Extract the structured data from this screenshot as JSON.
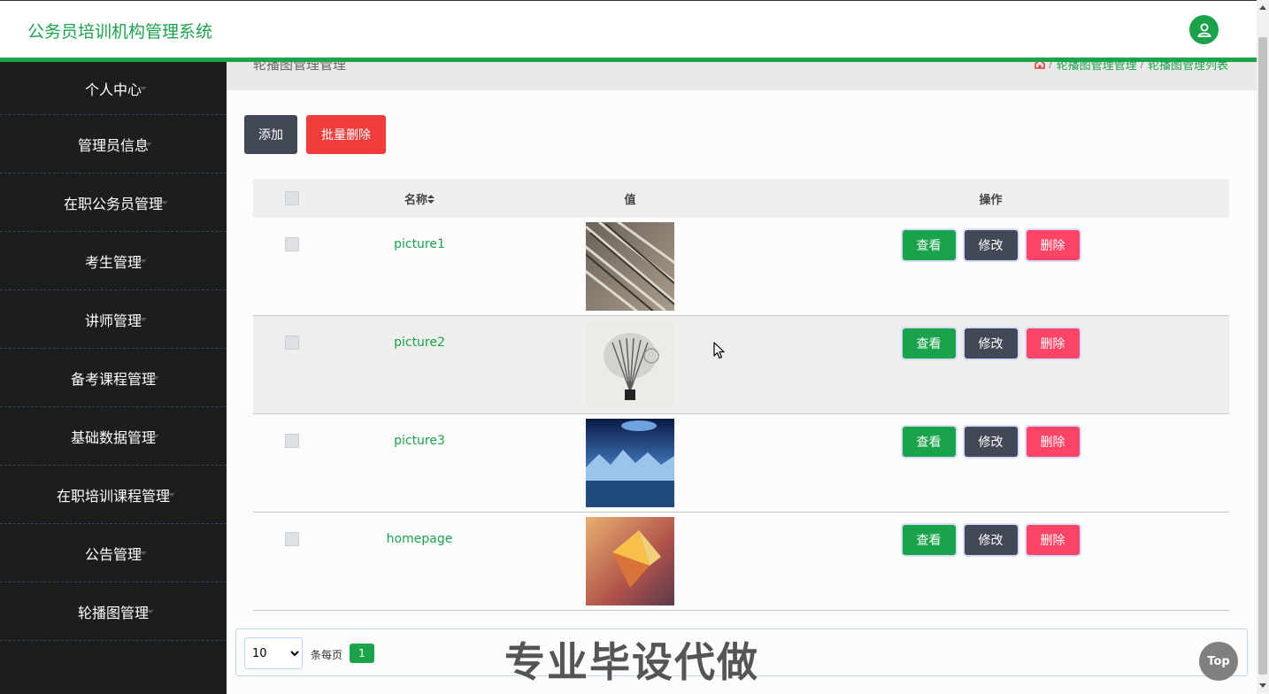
{
  "header": {
    "title": "公务员培训机构管理系统",
    "avatar_icon": "user-icon"
  },
  "sidebar": {
    "items": [
      {
        "label": "个人中心"
      },
      {
        "label": "管理员信息"
      },
      {
        "label": "在职公务员管理"
      },
      {
        "label": "考生管理"
      },
      {
        "label": "讲师管理"
      },
      {
        "label": "备考课程管理"
      },
      {
        "label": "基础数据管理"
      },
      {
        "label": "在职培训课程管理"
      },
      {
        "label": "公告管理"
      },
      {
        "label": "轮播图管理"
      }
    ]
  },
  "breadcrumb": {
    "page_title": "轮播图管理管理",
    "crumbs": [
      "轮播图管理管理",
      "轮播图管理列表"
    ],
    "separator": "/"
  },
  "toolbar": {
    "add_label": "添加",
    "batch_delete_label": "批量删除"
  },
  "table": {
    "headers": {
      "name": "名称",
      "value": "值",
      "ops": "操作"
    },
    "rows": [
      {
        "name": "picture1"
      },
      {
        "name": "picture2"
      },
      {
        "name": "picture3"
      },
      {
        "name": "homepage"
      }
    ],
    "ops": {
      "view": "查看",
      "edit": "修改",
      "delete": "删除"
    }
  },
  "pager": {
    "page_size": "10",
    "per_page_label": "条每页",
    "current_page": "1"
  },
  "watermark": "专业毕设代做",
  "top_button": "Top",
  "colors": {
    "primary": "#1aa34a",
    "dark": "#434856",
    "danger": "#ff4466",
    "sidebar_bg": "#1c1e1e"
  }
}
